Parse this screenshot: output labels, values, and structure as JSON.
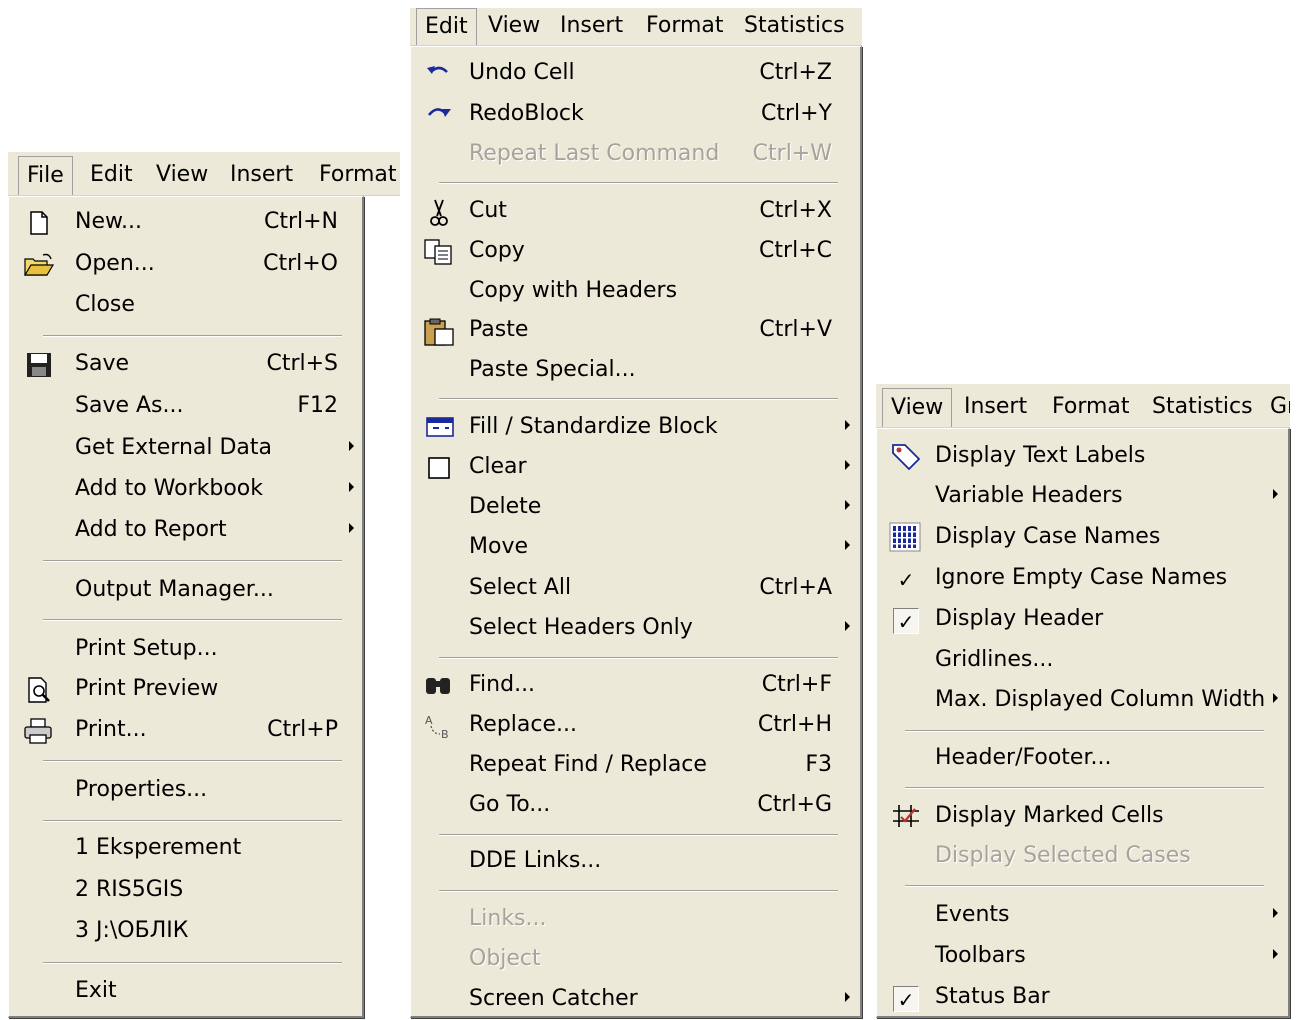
{
  "file_panel": {
    "menubar": [
      "File",
      "Edit",
      "View",
      "Insert",
      "Format"
    ],
    "items": [
      {
        "label": "New...",
        "shortcut": "Ctrl+N",
        "icon": "new-document-icon"
      },
      {
        "label": "Open...",
        "shortcut": "Ctrl+O",
        "icon": "open-folder-icon"
      },
      {
        "label": "Close",
        "shortcut": ""
      },
      {
        "label": "Save",
        "shortcut": "Ctrl+S",
        "icon": "save-disk-icon"
      },
      {
        "label": "Save As...",
        "shortcut": "F12"
      },
      {
        "label": "Get External Data",
        "submenu": true
      },
      {
        "label": "Add to Workbook",
        "submenu": true
      },
      {
        "label": "Add to Report",
        "submenu": true
      },
      {
        "label": "Output Manager...",
        "shortcut": ""
      },
      {
        "label": "Print Setup...",
        "shortcut": ""
      },
      {
        "label": "Print Preview",
        "shortcut": "",
        "icon": "print-preview-icon"
      },
      {
        "label": "Print...",
        "shortcut": "Ctrl+P",
        "icon": "printer-icon"
      },
      {
        "label": "Properties...",
        "shortcut": ""
      },
      {
        "label": "1 Eksperement",
        "shortcut": ""
      },
      {
        "label": "2 RIS5GIS",
        "shortcut": ""
      },
      {
        "label": "3 J:\\ОБЛІК",
        "shortcut": ""
      },
      {
        "label": "Exit",
        "shortcut": ""
      }
    ]
  },
  "edit_panel": {
    "menubar": [
      "Edit",
      "View",
      "Insert",
      "Format",
      "Statistics"
    ],
    "items": [
      {
        "label": "Undo Cell",
        "shortcut": "Ctrl+Z",
        "icon": "undo-icon"
      },
      {
        "label": "RedoBlock",
        "shortcut": "Ctrl+Y",
        "icon": "redo-icon"
      },
      {
        "label": "Repeat Last Command",
        "shortcut": "Ctrl+W",
        "disabled": true
      },
      {
        "label": "Cut",
        "shortcut": "Ctrl+X",
        "icon": "scissors-icon"
      },
      {
        "label": "Copy",
        "shortcut": "Ctrl+C",
        "icon": "copy-icon"
      },
      {
        "label": "Copy with Headers",
        "shortcut": ""
      },
      {
        "label": "Paste",
        "shortcut": "Ctrl+V",
        "icon": "clipboard-icon"
      },
      {
        "label": "Paste Special...",
        "shortcut": ""
      },
      {
        "label": "Fill / Standardize Block",
        "submenu": true,
        "icon": "fill-block-icon"
      },
      {
        "label": "Clear",
        "submenu": true,
        "icon": "clear-square-icon"
      },
      {
        "label": "Delete",
        "submenu": true
      },
      {
        "label": "Move",
        "submenu": true
      },
      {
        "label": "Select All",
        "shortcut": "Ctrl+A"
      },
      {
        "label": "Select Headers Only",
        "submenu": true
      },
      {
        "label": "Find...",
        "shortcut": "Ctrl+F",
        "icon": "binoculars-icon"
      },
      {
        "label": "Replace...",
        "shortcut": "Ctrl+H",
        "icon": "replace-icon"
      },
      {
        "label": "Repeat Find / Replace",
        "shortcut": "F3"
      },
      {
        "label": "Go To...",
        "shortcut": "Ctrl+G"
      },
      {
        "label": "DDE Links...",
        "shortcut": ""
      },
      {
        "label": "Links...",
        "shortcut": "",
        "disabled": true
      },
      {
        "label": "Object",
        "shortcut": "",
        "disabled": true
      },
      {
        "label": "Screen Catcher",
        "submenu": true
      }
    ]
  },
  "view_panel": {
    "menubar": [
      "View",
      "Insert",
      "Format",
      "Statistics",
      "Gr"
    ],
    "items": [
      {
        "label": "Display Text Labels",
        "icon": "tag-label-icon"
      },
      {
        "label": "Variable Headers",
        "submenu": true
      },
      {
        "label": "Display Case Names",
        "icon": "grid-dots-icon"
      },
      {
        "label": "Ignore Empty Case Names",
        "checked": true
      },
      {
        "label": "Display Header",
        "checked": true,
        "sunk": true
      },
      {
        "label": "Gridlines..."
      },
      {
        "label": "Max. Displayed Column Width",
        "submenu": true
      },
      {
        "label": "Header/Footer..."
      },
      {
        "label": "Display Marked Cells",
        "icon": "marked-cells-icon"
      },
      {
        "label": "Display Selected Cases",
        "disabled": true
      },
      {
        "label": "Events",
        "submenu": true
      },
      {
        "label": "Toolbars",
        "submenu": true
      },
      {
        "label": "Status Bar",
        "checked": true,
        "sunk": true
      }
    ]
  },
  "check_glyph": "✓"
}
